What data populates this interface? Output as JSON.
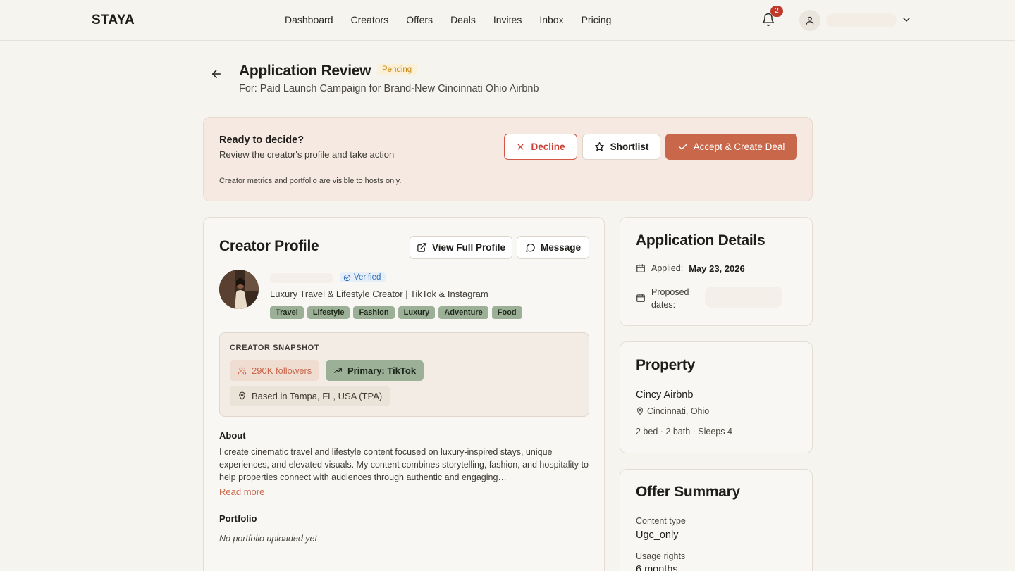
{
  "header": {
    "brand": "STAYA",
    "nav": [
      "Dashboard",
      "Creators",
      "Offers",
      "Deals",
      "Invites",
      "Inbox",
      "Pricing"
    ],
    "notification_count": "2"
  },
  "page": {
    "title": "Application Review",
    "status": "Pending",
    "subtitle": "For: Paid Launch Campaign for Brand-New Cincinnati Ohio Airbnb"
  },
  "decision": {
    "heading": "Ready to decide?",
    "subheading": "Review the creator's profile and take action",
    "note": "Creator metrics and portfolio are visible to hosts only.",
    "decline_label": "Decline",
    "shortlist_label": "Shortlist",
    "accept_label": "Accept & Create Deal"
  },
  "profile": {
    "title": "Creator Profile",
    "view_full_label": "View Full Profile",
    "message_label": "Message",
    "verified_label": "Verified",
    "tagline": "Luxury Travel & Lifestyle Creator | TikTok & Instagram",
    "tags": [
      "Travel",
      "Lifestyle",
      "Fashion",
      "Luxury",
      "Adventure",
      "Food"
    ],
    "snapshot": {
      "heading": "CREATOR SNAPSHOT",
      "followers": "290K followers",
      "primary": "Primary: TikTok",
      "location": "Based in Tampa, FL, USA (TPA)"
    },
    "about_heading": "About",
    "about_text": "I create cinematic travel and lifestyle content focused on luxury-inspired stays, unique experiences, and elevated visuals. My content combines storytelling, fashion, and hospitality to help properties connect with audiences through authentic and engaging…",
    "read_more": "Read more",
    "portfolio_heading": "Portfolio",
    "portfolio_empty": "No portfolio uploaded yet"
  },
  "application": {
    "title": "Application Details",
    "applied_label": "Applied:",
    "applied_value": "May 23, 2026",
    "proposed_label_1": "Proposed",
    "proposed_label_2": "dates:"
  },
  "property": {
    "title": "Property",
    "name": "Cincy Airbnb",
    "location": "Cincinnati, Ohio",
    "meta": "2 bed · 2 bath · Sleeps 4"
  },
  "offer": {
    "title": "Offer Summary",
    "content_type_label": "Content type",
    "content_type_value": "Ugc_only",
    "usage_label": "Usage rights",
    "usage_value": "6 months"
  },
  "colors": {
    "accent": "#c8674a",
    "tag_green": "#9bb097",
    "decline_red": "#d4564a",
    "badge_red": "#c0392b",
    "pending_bg": "#fbf0d8"
  }
}
